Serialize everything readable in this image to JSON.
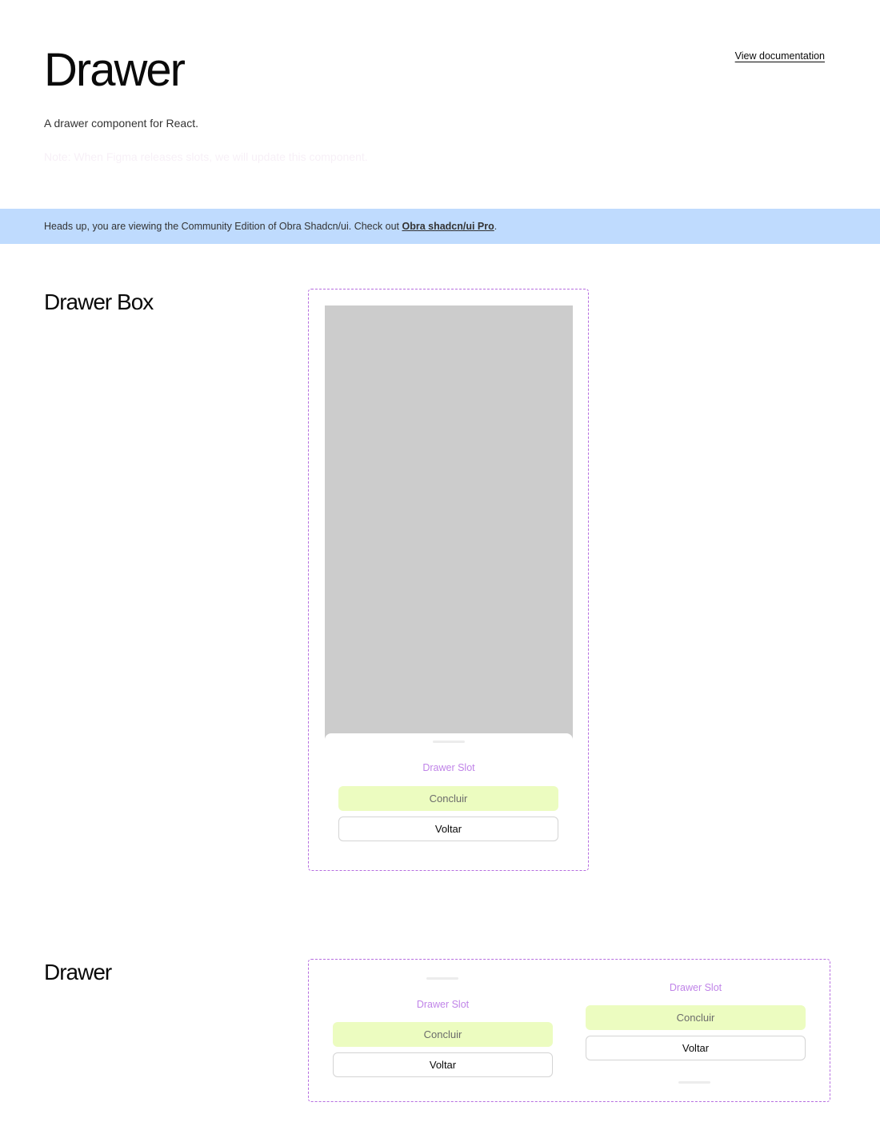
{
  "header": {
    "title": "Drawer",
    "doc_link": "View documentation",
    "subtitle": "A drawer component for React.",
    "note": "Note: When Figma releases slots, we will update this component."
  },
  "banner": {
    "text": "Heads up, you are viewing the Community Edition of Obra Shadcn/ui. Check out ",
    "link": "Obra shadcn/ui Pro",
    "suffix": "."
  },
  "sections": {
    "drawer_box": {
      "title": "Drawer Box",
      "slot_label": "Drawer Slot",
      "primary_label": "Concluir",
      "secondary_label": "Voltar"
    },
    "drawer": {
      "title": "Drawer",
      "left": {
        "slot_label": "Drawer Slot",
        "primary_label": "Concluir",
        "secondary_label": "Voltar"
      },
      "right": {
        "slot_label": "Drawer Slot",
        "primary_label": "Concluir",
        "secondary_label": "Voltar"
      }
    }
  },
  "colors": {
    "accent_dashed": "#b66ee0",
    "banner_bg": "#bfdbfe",
    "primary_button_bg": "#ecfcc0",
    "slot_text": "#c084e8",
    "placeholder_gray": "#cccccc"
  }
}
